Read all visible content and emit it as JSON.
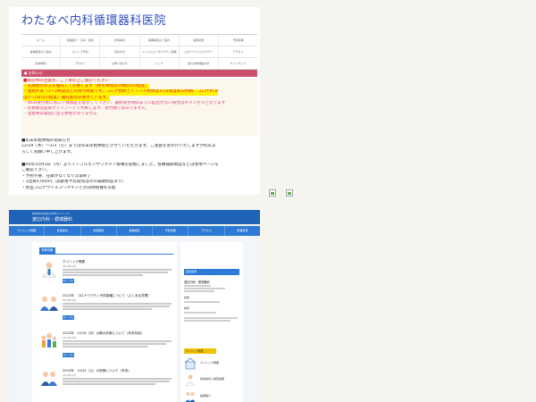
{
  "shot1": {
    "site_title": "わたなべ内科循環器科医院",
    "nav_row1": [
      "ホーム",
      "院長紹介・沿革・診療",
      "診療案内",
      "各種検査のご案内",
      "健康診断",
      "予防接種"
    ],
    "nav_row2": [
      "各種検査のご案内",
      "ネットで予約",
      "初診の方",
      "インフルエンザワクチン接種",
      "コロナウイルスワクチン",
      "アクセス"
    ],
    "nav_row3": [
      "診療時間",
      "アクセス",
      "お問い合わせ",
      "リンク",
      "個人情報保護方針",
      "サイトマップ"
    ],
    "notice_title": "お知らせ",
    "notice_lines": [
      "■受診時の注意点、ご了承の上ご受診ください",
      "・定期受診の方を優先して診療します（待ち時間は1時間以内程度）",
      "・発熱外来（1〜2時間ほどの待ち時間です。コロナ抗原とインフル抗原は15分程度即日判明、コロナPCR",
      "は1〜2日以内程度）優先者のみ受付ています。",
      "・WEB受付後に窓口で保険証を提示して下さい、最終受付時間までに提出がない場合はキャンセルとなります",
      "・診察順は医師がトリアージで判断します、受付順ではありません",
      "・混雑時は電話に出る余裕がありません"
    ],
    "block2_title": "■年末年始休暇のお知らせ",
    "block2_lines": [
      "12/29（木）〜1/3（火）までは年末年始休暇とさせていただきます。ご迷惑をおかけいたしますが何卒よ",
      "ろしくお願い申し上げます。"
    ],
    "block3_lines": [
      "■R4年10月3日（月）よりインフルエンザワクチン接種を開始しました。各種補助制度などは専用ページを",
      "ご確認下さい。",
      "・予約不要、在庫がなくなり次第終了",
      "・1回目4,000円（高齢者や乳幼児は市の補助制度あり）",
      "・新型コロナウイルスワクチンとの同時接種も可能"
    ]
  },
  "shot2": {
    "header_sub": "熊本市中央区の内科クリニック",
    "header_title": "渡辺内科・循環器科",
    "nav": [
      "クリニック概要",
      "診療案内",
      "診療時間",
      "各種検査",
      "予防接種",
      "アクセス",
      "新着情報"
    ],
    "section_tag": "新着情報",
    "posts": [
      {
        "title": "クリニック概要",
        "meta": "2022年12月",
        "more": "詳しく見る"
      },
      {
        "title": "2022年　コロナワクチン予防接種について（よくある質問）",
        "meta": "2022年12月",
        "more": "詳しく見る"
      },
      {
        "title": "2022年　12/26（月）以降の診療について（年末年始）",
        "meta": "2022年12月",
        "more": "詳しく見る"
      },
      {
        "title": "2022年　12/24（土）の診療について（年末）",
        "meta": "2022年12月",
        "more": "詳しく見る"
      }
    ],
    "side": {
      "tag": "医院情報",
      "name": "渡辺内科・循環器科",
      "hours_head": "診療",
      "closed_head": "休診",
      "link_tag": "クリニック概要",
      "links": [
        "クリニック概要",
        "診療案内と検査設備",
        "医師紹介"
      ]
    }
  },
  "colors": {
    "brand_blue": "#1e63b8",
    "nav_blue": "#2d79d6",
    "notice_red": "#c94f6a",
    "alert_red": "#e02020",
    "highlight_yellow": "#fff200"
  }
}
